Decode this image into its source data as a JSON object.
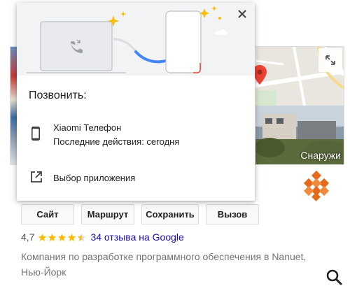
{
  "popup": {
    "title": "Позвонить:",
    "device": {
      "name": "Xiaomi Телефон",
      "activity": "Последние действия: сегодня"
    },
    "choose_app_label": "Выбор приложения",
    "close_icon": "close-icon"
  },
  "panel": {
    "photo_label": "Снаружи",
    "actions": [
      "Сайт",
      "Маршрут",
      "Сохранить",
      "Вызов"
    ],
    "rating": "4,7",
    "stars_value": 4.5,
    "reviews_link": "34 отзыва на Google",
    "description": "Компания по разработке программного обеспечения в Nanuet, Нью-Йорк"
  },
  "colors": {
    "accent_blue": "#4285f4",
    "star": "#fbbc04",
    "link": "#1a0dab",
    "pin": "#ea4335",
    "logo": "#e66a1c"
  }
}
